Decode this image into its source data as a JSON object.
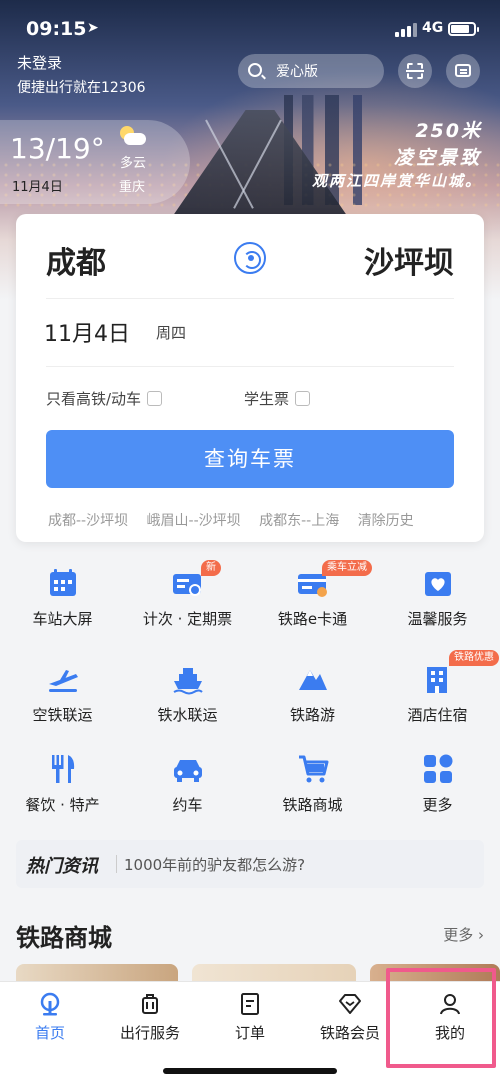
{
  "status": {
    "time": "09:15",
    "network": "4G"
  },
  "header": {
    "login_title": "未登录",
    "login_sub": "便捷出行就在12306",
    "search_placeholder": "爱心版"
  },
  "weather": {
    "temp": "13/19°",
    "date": "11月4日",
    "desc": "多云",
    "city": "重庆"
  },
  "banner": {
    "line1": "250米",
    "line2": "凌空景致",
    "line3": "观两江四岸赏华山城。"
  },
  "booking": {
    "from": "成都",
    "to": "沙坪坝",
    "date": "11月4日",
    "weekday": "周四",
    "option_high_speed": "只看高铁/动车",
    "option_student": "学生票",
    "search_button": "查询车票",
    "history": [
      "成都--沙坪坝",
      "峨眉山--沙坪坝",
      "成都东--上海"
    ],
    "clear_history": "清除历史"
  },
  "services": [
    {
      "label": "车站大屏",
      "icon": "calendar-icon"
    },
    {
      "label": "计次 · 定期票",
      "icon": "ticket-card-icon",
      "badge": "新"
    },
    {
      "label": "铁路e卡通",
      "icon": "ecard-icon",
      "badge": "乘车立减"
    },
    {
      "label": "温馨服务",
      "icon": "heart-service-icon"
    },
    {
      "label": "空铁联运",
      "icon": "plane-icon"
    },
    {
      "label": "铁水联运",
      "icon": "ship-icon"
    },
    {
      "label": "铁路游",
      "icon": "mountain-icon"
    },
    {
      "label": "酒店住宿",
      "icon": "hotel-icon",
      "badge": "铁路优惠"
    },
    {
      "label": "餐饮 · 特产",
      "icon": "food-icon"
    },
    {
      "label": "约车",
      "icon": "car-icon"
    },
    {
      "label": "铁路商城",
      "icon": "cart-icon"
    },
    {
      "label": "更多",
      "icon": "more-grid-icon"
    }
  ],
  "news": {
    "tag": "热门资讯",
    "text": "1000年前的驴友都怎么游?"
  },
  "mall": {
    "title": "铁路商城",
    "more": "更多"
  },
  "tabs": [
    {
      "label": "首页",
      "icon": "home-icon"
    },
    {
      "label": "出行服务",
      "icon": "luggage-icon"
    },
    {
      "label": "订单",
      "icon": "order-icon"
    },
    {
      "label": "铁路会员",
      "icon": "diamond-icon"
    },
    {
      "label": "我的",
      "icon": "user-icon"
    }
  ],
  "colors": {
    "accent": "#3b7cf0",
    "button": "#4e8ff5",
    "badge": "#f36c4b",
    "highlight": "#f05a8c"
  }
}
